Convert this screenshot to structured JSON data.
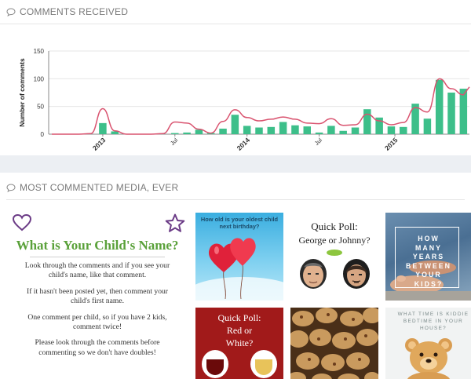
{
  "comments_section": {
    "title": "COMMENTS RECEIVED",
    "icon": "speech-bubble-icon"
  },
  "chart_data": {
    "type": "bar",
    "ylabel": "Number of comments",
    "ylim": [
      0,
      150
    ],
    "yticks": [
      0,
      50,
      100,
      150
    ],
    "x_tick_labels": [
      "2013",
      "Jul",
      "2014",
      "Jul",
      "2015"
    ],
    "bar_color": "#3dbf8a",
    "line_color": "#d9536f",
    "values": [
      0,
      0,
      0,
      0,
      20,
      5,
      0,
      0,
      0,
      0,
      2,
      3,
      8,
      2,
      10,
      35,
      15,
      12,
      13,
      22,
      16,
      14,
      3,
      15,
      6,
      12,
      45,
      30,
      14,
      13,
      55,
      28,
      98,
      75,
      82
    ],
    "trend": [
      0,
      0,
      0,
      1,
      46,
      6,
      0,
      0,
      0,
      1,
      22,
      20,
      9,
      2,
      23,
      44,
      30,
      24,
      27,
      31,
      27,
      20,
      19,
      28,
      16,
      17,
      36,
      24,
      17,
      21,
      48,
      40,
      100,
      82,
      71
    ]
  },
  "media_section": {
    "title": "MOST COMMENTED MEDIA, EVER",
    "icon": "speech-bubble-icon"
  },
  "media": {
    "featured": {
      "title": "What is Your Child's Name?",
      "paragraphs": [
        "Look through the comments and if you see your child's name, like that comment.",
        "If it hasn't been posted yet, then comment your child's first name.",
        "One comment per child, so if you have 2 kids, comment twice!",
        "Please look through the comments before commenting so we don't have doubles!"
      ]
    },
    "balloons": {
      "question": "How old is your oldest child next birthday?"
    },
    "poll_george": {
      "title": "Quick Poll:",
      "subtitle": "George or Johnny?"
    },
    "feet": {
      "text": "HOW MANY YEARS BETWEEN YOUR KIDS?"
    },
    "poll_wine": {
      "title": "Quick Poll:",
      "line2": "Red or",
      "line3": "White?"
    },
    "bedtime": {
      "text": "WHAT TIME IS KIDDIE BEDTIME IN YOUR HOUSE?"
    }
  }
}
